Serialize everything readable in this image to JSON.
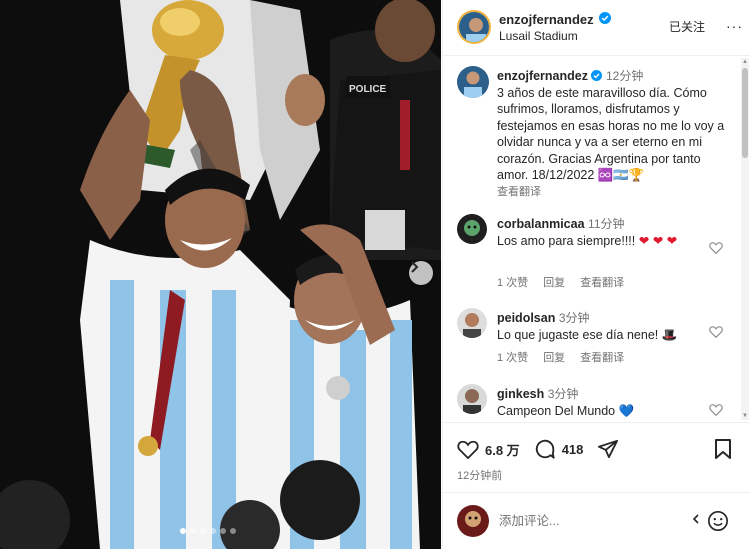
{
  "post": {
    "username": "enzojfernandez",
    "location": "Lusail Stadium",
    "follow_label": "已关注",
    "more_label": "···",
    "caption": {
      "username": "enzojfernandez",
      "time": "12分钟",
      "text": "3 años de este maravilloso día. Cómo sufrimos, lloramos, disfrutamos y festejamos en esas horas no me lo voy a olvidar nunca y va a ser eterno en mi corazón. Gracias Argentina por tanto amor. 18/12/2022",
      "emoji_suffix": "♾️🇦🇷🏆",
      "translate_label": "查看翻译"
    },
    "comments": [
      {
        "username": "corbalanmicaa",
        "time": "11分钟",
        "text": "Los amo para siempre!!!!",
        "emoji": "❤ ❤ ❤",
        "likes": "1 次赞",
        "reply": "回复",
        "translate": "查看翻译"
      },
      {
        "username": "peidolsan",
        "time": "3分钟",
        "text": "Lo que jugaste ese día nene!",
        "emoji": "🎩",
        "likes": "1 次赞",
        "reply": "回复",
        "translate": "查看翻译"
      },
      {
        "username": "ginkesh",
        "time": "3分钟",
        "text": "Campeon Del Mundo",
        "emoji": "💙",
        "likes": "",
        "reply": "",
        "translate": ""
      }
    ],
    "likes_count": "6.8 万",
    "comments_count": "418",
    "timestamp": "12分钟前",
    "add_comment_placeholder": "添加评论...",
    "carousel": {
      "dots": 6,
      "active_index": 0
    },
    "colors": {
      "text": "#262626",
      "secondary": "#737373",
      "heart": "#e0182d",
      "blue_heart": "#2f6fd6",
      "verified": "#0095f6"
    }
  }
}
